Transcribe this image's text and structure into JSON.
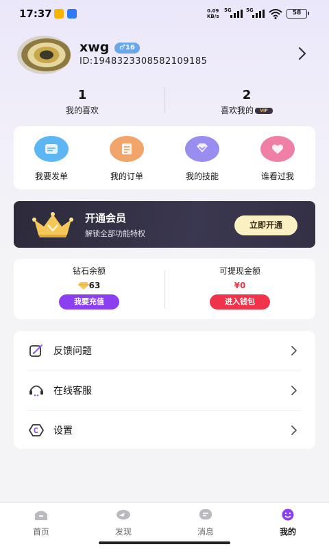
{
  "status_bar": {
    "time": "17:37",
    "speed_value": "0.09",
    "speed_unit": "KB/s",
    "net1": "5G",
    "net2": "5G",
    "battery": "58"
  },
  "profile": {
    "username": "xwg",
    "level_badge": "♂16",
    "user_id": "ID:1948323308582109185"
  },
  "stats": [
    {
      "value": "1",
      "label": "我的喜欢"
    },
    {
      "value": "2",
      "label": "喜欢我的",
      "badge": "VIP"
    }
  ],
  "functions": [
    {
      "label": "我要发单",
      "icon": "list-icon",
      "color": "#5cb6f2"
    },
    {
      "label": "我的订单",
      "icon": "order-icon",
      "color": "#f2a56b"
    },
    {
      "label": "我的技能",
      "icon": "skill-icon",
      "color": "#9a8df0"
    },
    {
      "label": "谁看过我",
      "icon": "heart-icon",
      "color": "#f07fa6"
    }
  ],
  "vip": {
    "title": "开通会员",
    "subtitle": "解锁全部功能特权",
    "button": "立即开通"
  },
  "balances": {
    "diamond": {
      "label": "钻石余额",
      "value": "63",
      "button": "我要充值",
      "button_color": "#8b3ff0"
    },
    "cash": {
      "label": "可提现金额",
      "value": "¥0",
      "button": "进入钱包",
      "button_color": "#f0334a"
    }
  },
  "menu": [
    {
      "label": "反馈问题",
      "icon": "feedback-icon"
    },
    {
      "label": "在线客服",
      "icon": "headset-icon"
    },
    {
      "label": "设置",
      "icon": "settings-icon"
    }
  ],
  "tabs": [
    {
      "label": "首页",
      "icon": "home-icon"
    },
    {
      "label": "发现",
      "icon": "discover-icon"
    },
    {
      "label": "消息",
      "icon": "message-icon"
    },
    {
      "label": "我的",
      "icon": "profile-icon",
      "active": true
    }
  ],
  "colors": {
    "accent": "#7b4be8",
    "vip_gold": "#f5c65a",
    "background": "#f4f4f6"
  }
}
